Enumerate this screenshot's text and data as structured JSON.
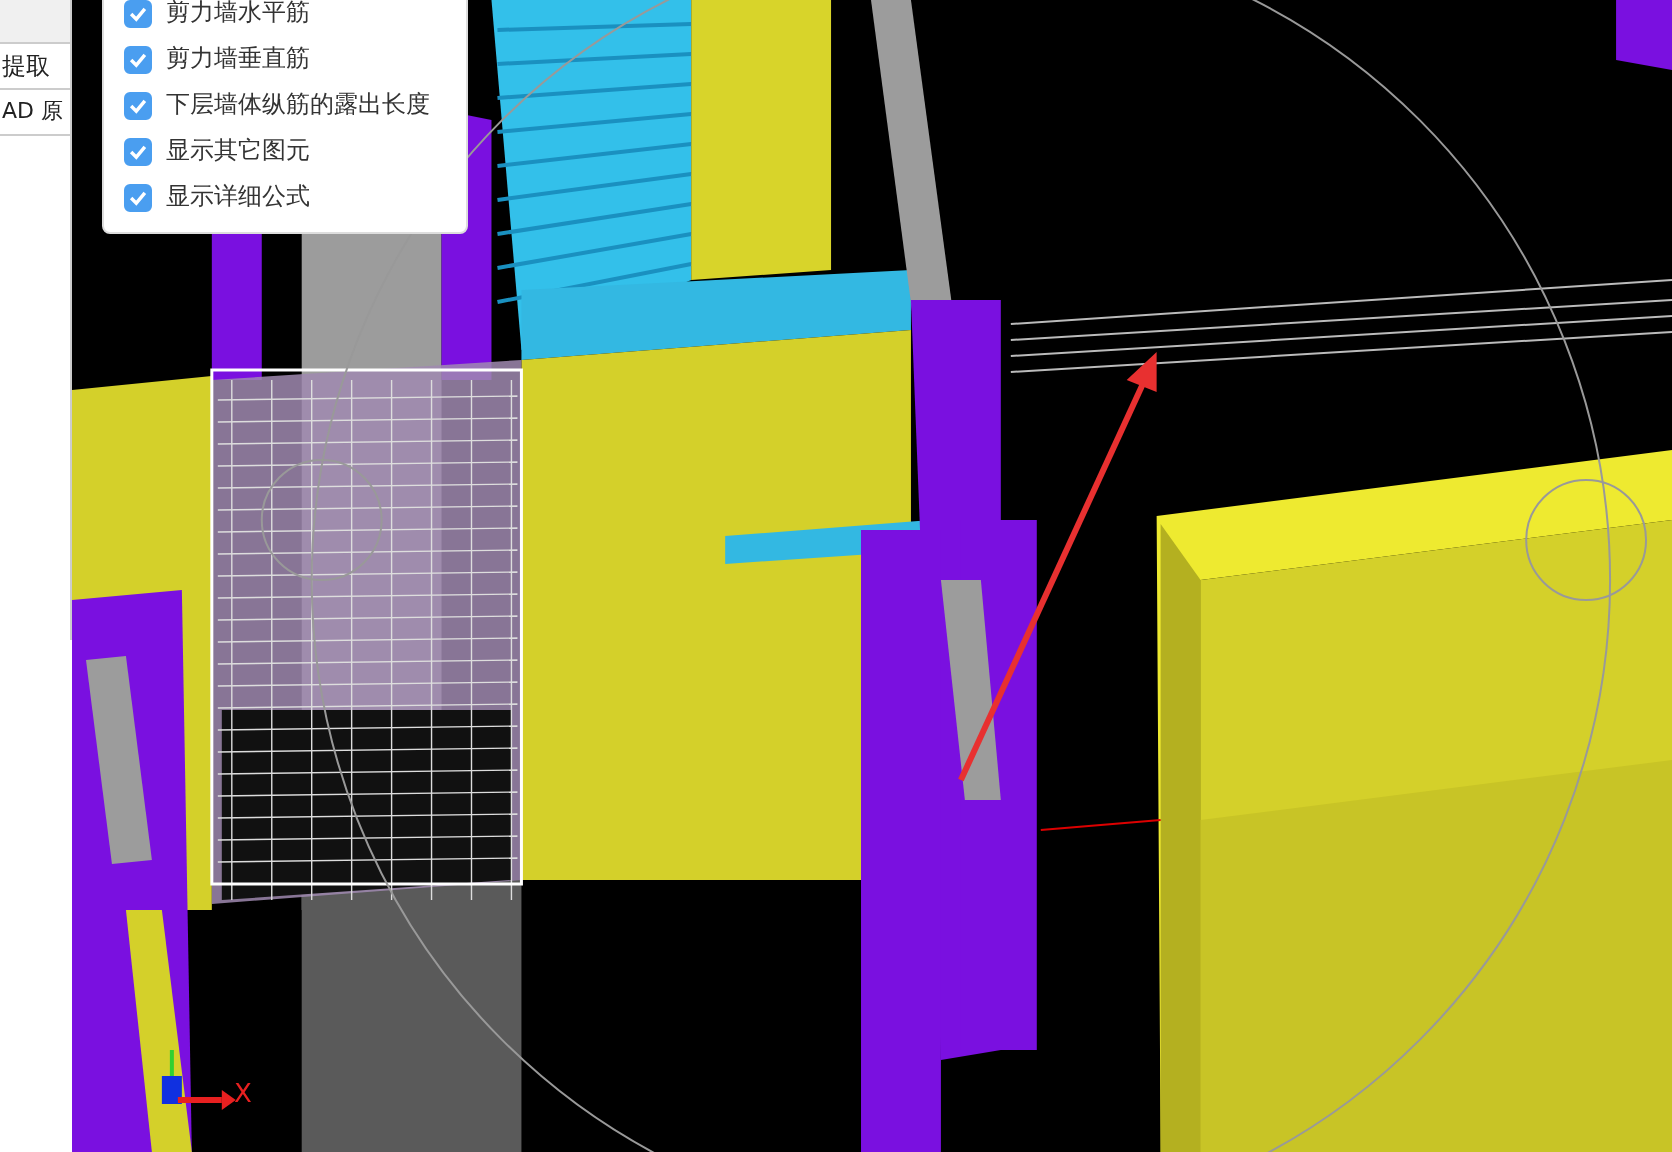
{
  "left_panel": {
    "rows": [
      "提取",
      "AD 原"
    ]
  },
  "display_options": [
    {
      "label": "剪力墙水平筋",
      "checked": true
    },
    {
      "label": "剪力墙垂直筋",
      "checked": true
    },
    {
      "label": "下层墙体纵筋的露出长度",
      "checked": true
    },
    {
      "label": "显示其它图元",
      "checked": true
    },
    {
      "label": "显示详细公式",
      "checked": true
    }
  ],
  "axis": {
    "x_label": "X"
  }
}
